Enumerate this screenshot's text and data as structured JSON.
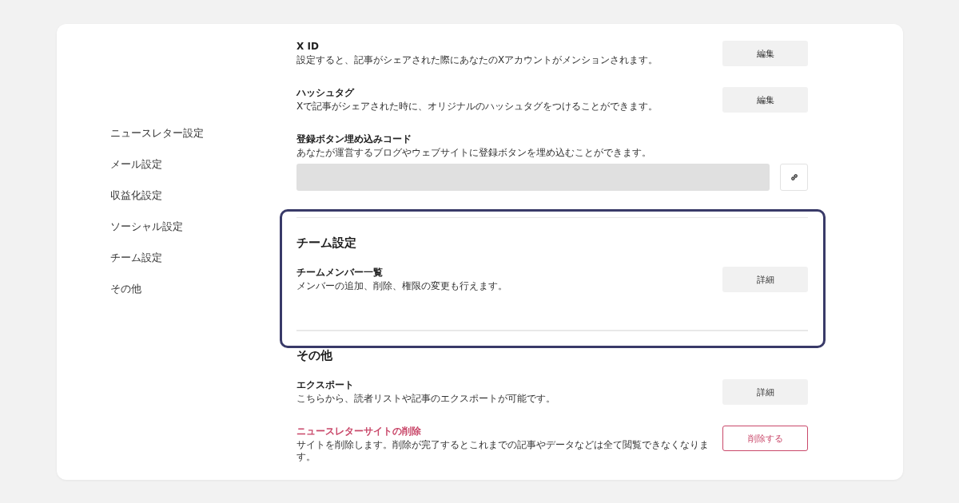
{
  "sidebar": {
    "items": [
      {
        "label": "ニュースレター設定"
      },
      {
        "label": "メール設定"
      },
      {
        "label": "収益化設定"
      },
      {
        "label": "ソーシャル設定"
      },
      {
        "label": "チーム設定"
      },
      {
        "label": "その他"
      }
    ]
  },
  "sections": [
    {
      "highlighted": false,
      "items": [
        {
          "kind": "button",
          "title": "X ID",
          "description": "設定すると、記事がシェアされた際にあなたのXアカウントがメンションされます。",
          "button": "編集"
        },
        {
          "kind": "button",
          "title": "ハッシュタグ",
          "description": "Xで記事がシェアされた時に、オリジナルのハッシュタグをつけることができます。",
          "button": "編集"
        },
        {
          "kind": "embed",
          "title": "登録ボタン埋め込みコード",
          "description": "あなたが運営するブログやウェブサイトに登録ボタンを埋め込むことができます。"
        }
      ]
    },
    {
      "title": "チーム設定",
      "highlighted": true,
      "items": [
        {
          "kind": "button",
          "title": "チームメンバー一覧",
          "description": "メンバーの追加、削除、権限の変更も行えます。",
          "button": "詳細"
        }
      ]
    },
    {
      "title": "その他",
      "highlighted": false,
      "items": [
        {
          "kind": "button",
          "title": "エクスポート",
          "description": "こちらから、読者リストや記事のエクスポートが可能です。",
          "button": "詳細"
        },
        {
          "kind": "danger",
          "title": "ニュースレターサイトの削除",
          "description": "サイトを削除します。削除が完了するとこれまでの記事やデータなどは全て閲覧できなくなります。",
          "button": "削除する"
        }
      ]
    }
  ]
}
